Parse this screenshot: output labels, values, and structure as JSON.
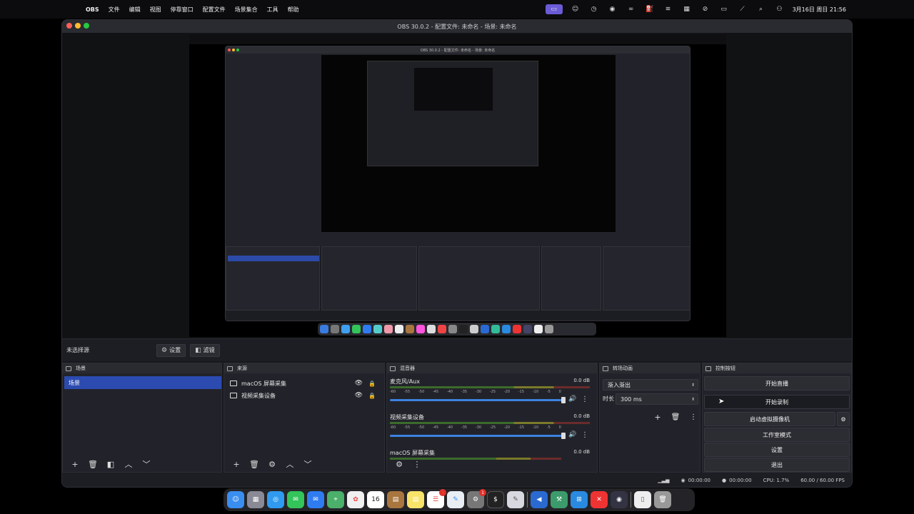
{
  "menubar": {
    "app_name": "OBS",
    "items": [
      "文件",
      "编辑",
      "视图",
      "停靠窗口",
      "配置文件",
      "场景集合",
      "工具",
      "帮助"
    ],
    "clock": "3月16日 周日 21:56"
  },
  "window": {
    "title": "OBS 30.0.2 - 配置文件: 未命名 - 场景: 未命名"
  },
  "preview": {
    "nested_title": "OBS 30.0.2 - 配置文件: 未命名 - 场景: 未命名"
  },
  "source_bar": {
    "label": "未选择源",
    "settings_label": "设置",
    "filters_label": "滤镜"
  },
  "scenes": {
    "title": "场景",
    "items": [
      "场景"
    ]
  },
  "sources": {
    "title": "来源",
    "items": [
      "macOS 屏幕采集",
      "视频采集设备"
    ]
  },
  "mixer": {
    "title": "混音器",
    "channels": [
      {
        "name": "麦克风/Aux",
        "db": "0.0 dB"
      },
      {
        "name": "视频采集设备",
        "db": "0.0 dB"
      },
      {
        "name": "macOS 屏幕采集",
        "db": "0.0 dB"
      }
    ],
    "ticks": [
      "-60",
      "-55",
      "-50",
      "-45",
      "-40",
      "-35",
      "-30",
      "-25",
      "-20",
      "-15",
      "-10",
      "-5",
      "0"
    ]
  },
  "transitions": {
    "title": "转场动画",
    "selected": "渐入渐出",
    "duration_label": "时长",
    "duration_value": "300 ms"
  },
  "controls": {
    "title": "控制按钮",
    "start_stream": "开始直播",
    "start_record": "开始录制",
    "virtual_cam": "启动虚拟摄像机",
    "studio_mode": "工作室模式",
    "settings": "设置",
    "exit": "退出"
  },
  "status": {
    "stream_time": "00:00:00",
    "record_time": "00:00:00",
    "cpu": "CPU: 1.7%",
    "fps": "60.00 / 60.00 FPS"
  },
  "dock": {
    "calendar_day": "16",
    "badge1": "1",
    "badge2": "1"
  },
  "colors": {
    "accent": "#2b4bb0",
    "slider": "#3c82e0",
    "bg": "#1d1e24"
  }
}
